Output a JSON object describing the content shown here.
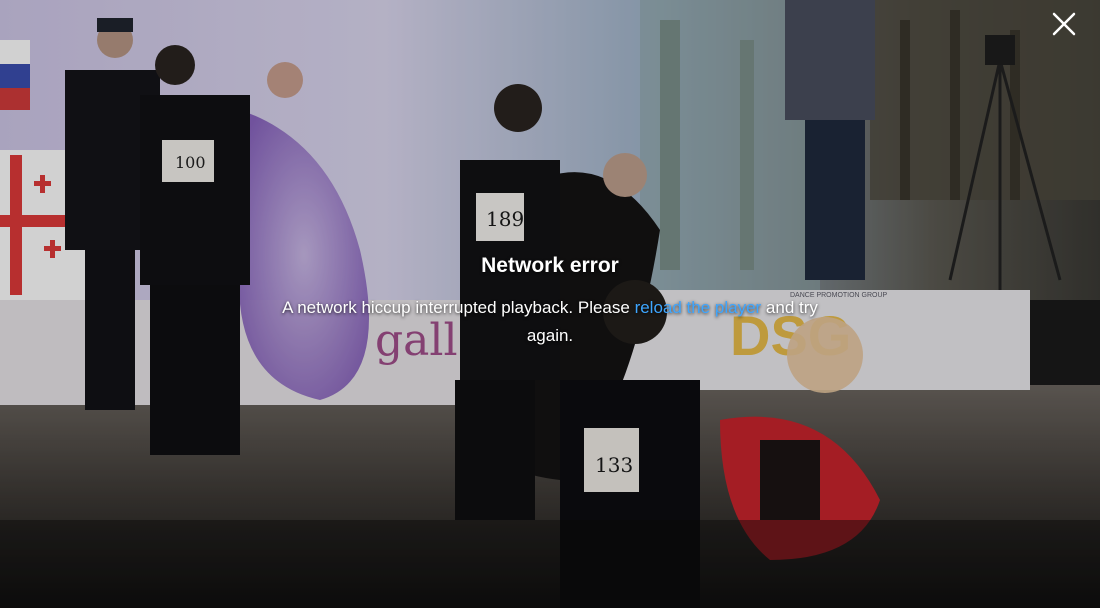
{
  "error": {
    "title": "Network error",
    "message_before": "A network hiccup interrupted playback. Please ",
    "link_text": "reload the player",
    "message_after": " and try again."
  },
  "scene": {
    "bibs": [
      "189",
      "133",
      "100"
    ],
    "banner_text": "gall",
    "sponsor_logo": "DSG",
    "sponsor_caption": "DANCE PROMOTION GROUP"
  },
  "icons": {
    "close": "close-icon"
  },
  "colors": {
    "link": "#3ea6ff",
    "overlay_text": "#ffffff"
  }
}
